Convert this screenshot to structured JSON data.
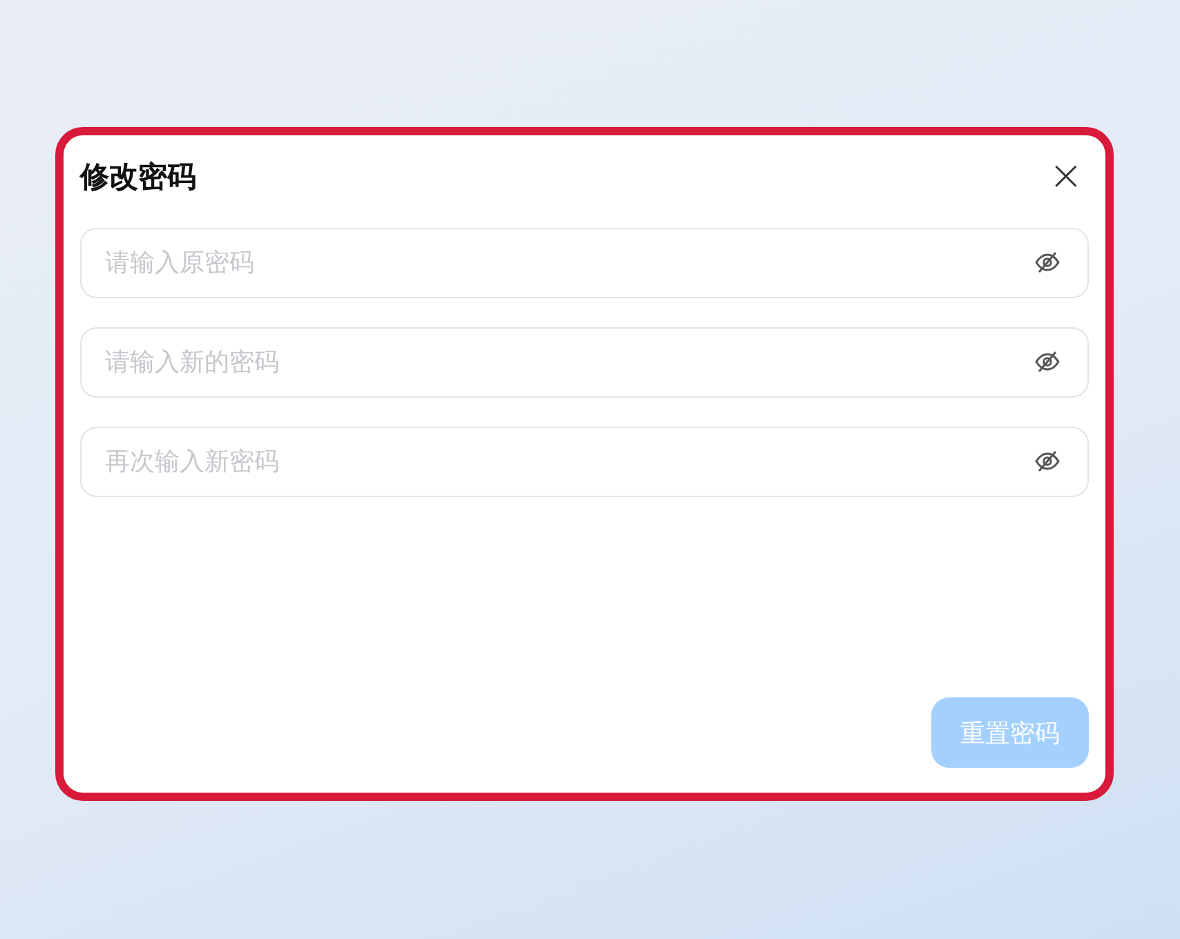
{
  "dialog": {
    "title": "修改密码",
    "close": "×"
  },
  "fields": [
    {
      "placeholder": "请输入原密码",
      "password_visible": false
    },
    {
      "placeholder": "请输入新的密码",
      "password_visible": false
    },
    {
      "placeholder": "再次输入新密码",
      "password_visible": false
    }
  ],
  "submit": {
    "label": "重置密码",
    "disabled": true
  }
}
